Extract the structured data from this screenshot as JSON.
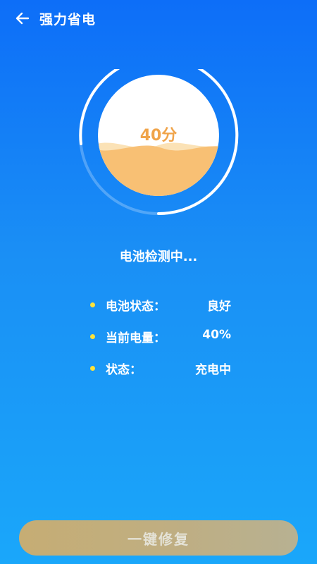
{
  "header": {
    "title": "强力省电",
    "back_icon": "arrow-left-icon"
  },
  "gauge": {
    "score_text": "40分",
    "level_percent": 40,
    "colors": {
      "score": "#f0a44a",
      "wave_front": "#f7bd6f",
      "wave_back": "#fbe2b6",
      "ring": "#ffffff"
    }
  },
  "status": {
    "text": "电池检测中..."
  },
  "info": [
    {
      "label": "电池状态：",
      "value": "良好"
    },
    {
      "label": "当前电量：",
      "value": "40%"
    },
    {
      "label": "状态：",
      "value": "充电中"
    }
  ],
  "action": {
    "label": "一键修复"
  },
  "colors": {
    "bullet": "#ffe23a",
    "button": "#c6ad74"
  }
}
